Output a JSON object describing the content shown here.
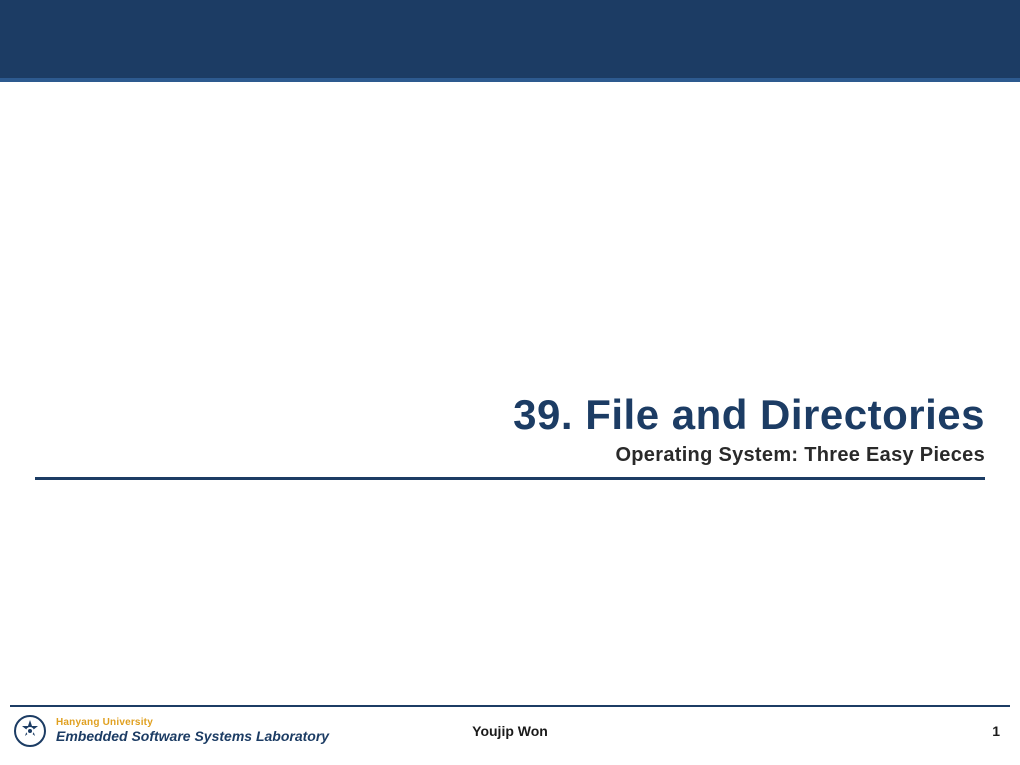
{
  "slide": {
    "title": "39. File and Directories",
    "subtitle": "Operating System: Three Easy Pieces"
  },
  "footer": {
    "university": "Hanyang University",
    "lab": "Embedded Software Systems Laboratory",
    "author": "Youjip Won",
    "page": "1"
  },
  "colors": {
    "banner": "#1c3c64",
    "accent": "#2d5a8f",
    "gold": "#e0a020"
  }
}
